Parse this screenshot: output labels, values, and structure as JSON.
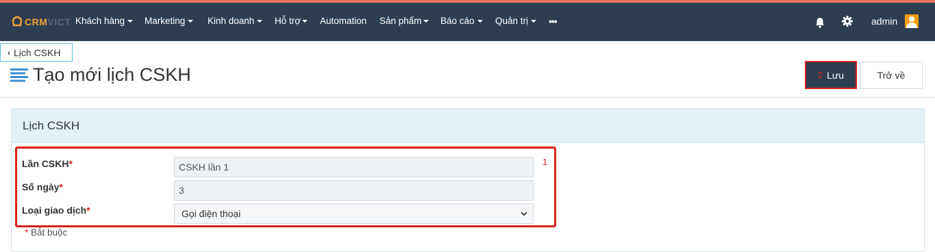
{
  "brand": {
    "logo_text_a": "CRM",
    "logo_text_b": "VICT"
  },
  "nav": {
    "items": [
      {
        "label": "Khách hàng",
        "has_caret": true
      },
      {
        "label": "Marketing",
        "has_caret": true
      },
      {
        "label": "Kinh doanh",
        "has_caret": true
      },
      {
        "label": "Hỗ trợ",
        "has_caret": true
      },
      {
        "label": "Automation",
        "has_caret": false
      },
      {
        "label": "Sản phẩm",
        "has_caret": true
      },
      {
        "label": "Báo cáo",
        "has_caret": true
      },
      {
        "label": "Quản trị",
        "has_caret": true
      }
    ],
    "more": "•••",
    "user": "admin"
  },
  "breadcrumb": {
    "back_label": "Lịch CSKH"
  },
  "page": {
    "title": "Tạo mới lịch CSKH"
  },
  "actions": {
    "save_label": "Lưu",
    "save_annotation": "2",
    "back_label": "Trở về"
  },
  "form": {
    "panel_title": "Lịch CSKH",
    "annotation": "1",
    "fields": [
      {
        "label": "Lần CSKH",
        "required_mark": "*",
        "value": "CSKH lần 1"
      },
      {
        "label": "Số ngày",
        "required_mark": "*",
        "value": "3"
      },
      {
        "label": "Loại giao dịch",
        "required_mark": "*",
        "value": "Gọi điện thoại"
      }
    ],
    "required_note_mark": "*",
    "required_note": "Bắt buộc"
  },
  "colors": {
    "navbar": "#2d3e50",
    "accent_orange": "#f1a239",
    "annotation_red": "#d9201d",
    "panel_header": "#e3f1f7"
  }
}
